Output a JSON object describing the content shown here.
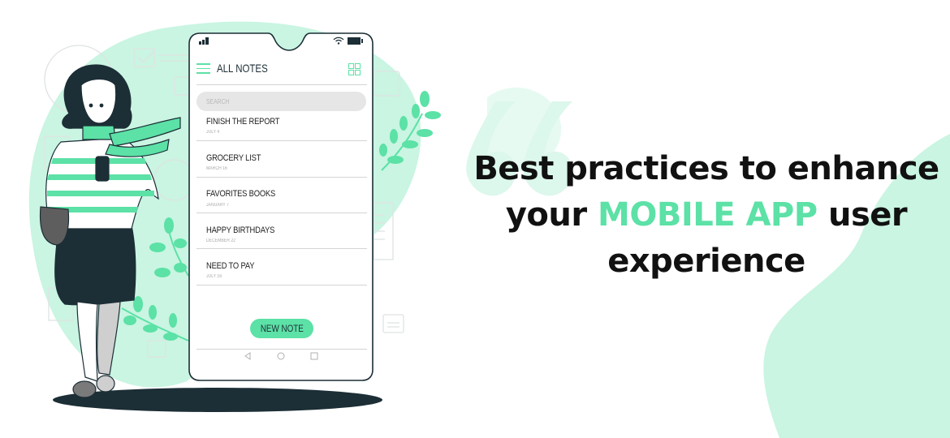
{
  "colors": {
    "accent": "#5ce1a6",
    "accent_light": "#c9f5e2",
    "dark": "#1c2e36",
    "text": "#111111",
    "muted": "#aaaaaa"
  },
  "phone": {
    "header_title": "ALL NOTES",
    "menu_icon": "hamburger-icon",
    "grid_icon": "grid-view-icon",
    "search_placeholder": "SEARCH",
    "notes": [
      {
        "title": "FINISH THE REPORT",
        "date": "JULY 4"
      },
      {
        "title": "GROCERY LIST",
        "date": "MARCH 16"
      },
      {
        "title": "FAVORITES BOOKS",
        "date": "JANUARY 7"
      },
      {
        "title": "HAPPY BIRTHDAYS",
        "date": "DECEMBER 22"
      },
      {
        "title": "NEED TO PAY",
        "date": "JULY 16"
      }
    ],
    "new_note_label": "NEW NOTE",
    "nav": [
      "back-icon",
      "home-icon",
      "recents-icon"
    ]
  },
  "headline": {
    "line1": "Best practices to enhance",
    "line2_pre": "your ",
    "line2_accent": "MOBILE APP",
    "line2_post": " user",
    "line3": "experience"
  }
}
